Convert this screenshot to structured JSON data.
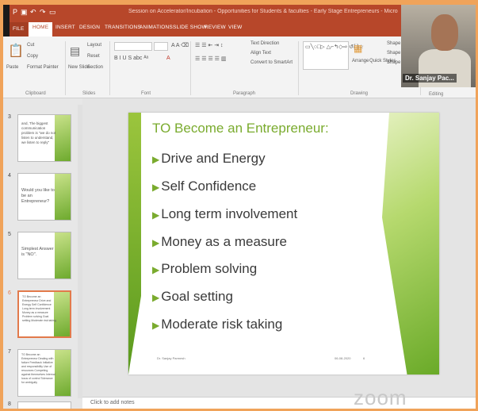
{
  "window": {
    "title": "Session on Accelerator/Incubation - Opportunities for Students & faculties - Early Stage Entrepreneurs - Microsoft PowerPoint"
  },
  "ribbon_tabs": [
    "FILE",
    "HOME",
    "INSERT",
    "DESIGN",
    "TRANSITIONS",
    "ANIMATIONS",
    "SLIDE SHOW",
    "REVIEW",
    "VIEW"
  ],
  "ribbon": {
    "clipboard": {
      "paste": "Paste",
      "cut": "Cut",
      "copy": "Copy",
      "format_painter": "Format Painter",
      "label": "Clipboard"
    },
    "slides": {
      "new_slide": "New Slide",
      "layout": "Layout",
      "reset": "Reset",
      "section": "Section",
      "label": "Slides"
    },
    "font": {
      "label": "Font"
    },
    "paragraph": {
      "text_direction": "Text Direction",
      "align_text": "Align Text",
      "convert_smartart": "Convert to SmartArt",
      "label": "Paragraph"
    },
    "drawing": {
      "arrange": "Arrange",
      "quick_styles": "Quick Styles",
      "shape_fill": "Shape F",
      "shape_outline": "Shape O",
      "shape_effects": "Shape E",
      "label": "Drawing"
    },
    "editing": {
      "label": "Editing"
    }
  },
  "thumbnails": [
    {
      "num": "3",
      "text": "and, The biggest communication problem is \"we do not listen to understand, we listen to reply\""
    },
    {
      "num": "4",
      "text": "Would you like to be an Entrepreneur?"
    },
    {
      "num": "5",
      "text": "Simplest Answer is \"NO\"."
    },
    {
      "num": "6",
      "text": "TO Become an Entrepreneur Drive and Energy Self Confidence Long term involvement Money as a measure Problem solving Goal setting Moderate risk taking"
    },
    {
      "num": "7",
      "text": "TO Become an Entrepreneur Dealing with failure Feedback Initiative and responsibility Use of resources Competing against themselves Internal locus of control Tolerance for ambiguity"
    },
    {
      "num": "8",
      "text": ""
    }
  ],
  "slide": {
    "title": "TO Become an Entrepreneur:",
    "bullets": [
      "Drive and Energy",
      "Self Confidence",
      "Long term involvement",
      "Money as a measure",
      "Problem solving",
      "Goal setting",
      "Moderate risk taking"
    ],
    "footer_left": "Dr. Sanjay Parmesh",
    "footer_date": "06-08-2020",
    "footer_num": "6"
  },
  "notes_placeholder": "Click to add notes",
  "webcam": {
    "name": "Dr. Sanjay Pac..."
  },
  "zoom_watermark": "zoom",
  "colors": {
    "ppt_red": "#b7472a",
    "green_accent": "#7aab2e",
    "selected_border": "#e27a4b"
  }
}
